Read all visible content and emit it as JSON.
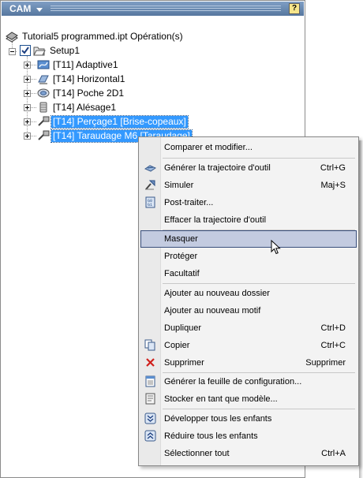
{
  "panel": {
    "title": "CAM",
    "help": "?"
  },
  "tree": {
    "root": "Tutorial5 programmed.ipt Opération(s)",
    "setup": "Setup1",
    "ops": [
      "[T11] Adaptive1",
      "[T14] Horizontal1",
      "[T14] Poche 2D1",
      "[T14] Alésage1",
      "[T14] Perçage1 [Brise-copeaux]",
      "[T14] Taraudage M6 [Taraudage]"
    ]
  },
  "menu": {
    "compare": "Comparer et modifier...",
    "generate": {
      "label": "Générer la trajectoire d'outil",
      "shortcut": "Ctrl+G"
    },
    "simulate": {
      "label": "Simuler",
      "shortcut": "Maj+S"
    },
    "post": "Post-traiter...",
    "clear": "Effacer la trajectoire d'outil",
    "hide": "Masquer",
    "protect": "Protéger",
    "optional": "Facultatif",
    "add_folder": "Ajouter au nouveau dossier",
    "add_pattern": "Ajouter au nouveau motif",
    "duplicate": {
      "label": "Dupliquer",
      "shortcut": "Ctrl+D"
    },
    "copy": {
      "label": "Copier",
      "shortcut": "Ctrl+C"
    },
    "delete": {
      "label": "Supprimer",
      "shortcut": "Supprimer"
    },
    "setup_sheet": "Générer la feuille de configuration...",
    "store_template": "Stocker en tant que modèle...",
    "expand_all": "Développer tous les enfants",
    "collapse_all": "Réduire tous les enfants",
    "select_all": {
      "label": "Sélectionner tout",
      "shortcut": "Ctrl+A"
    }
  },
  "colors": {
    "selection": "#3399ff",
    "header": "#56779f",
    "menu_highlight": "#c3cbe0"
  }
}
